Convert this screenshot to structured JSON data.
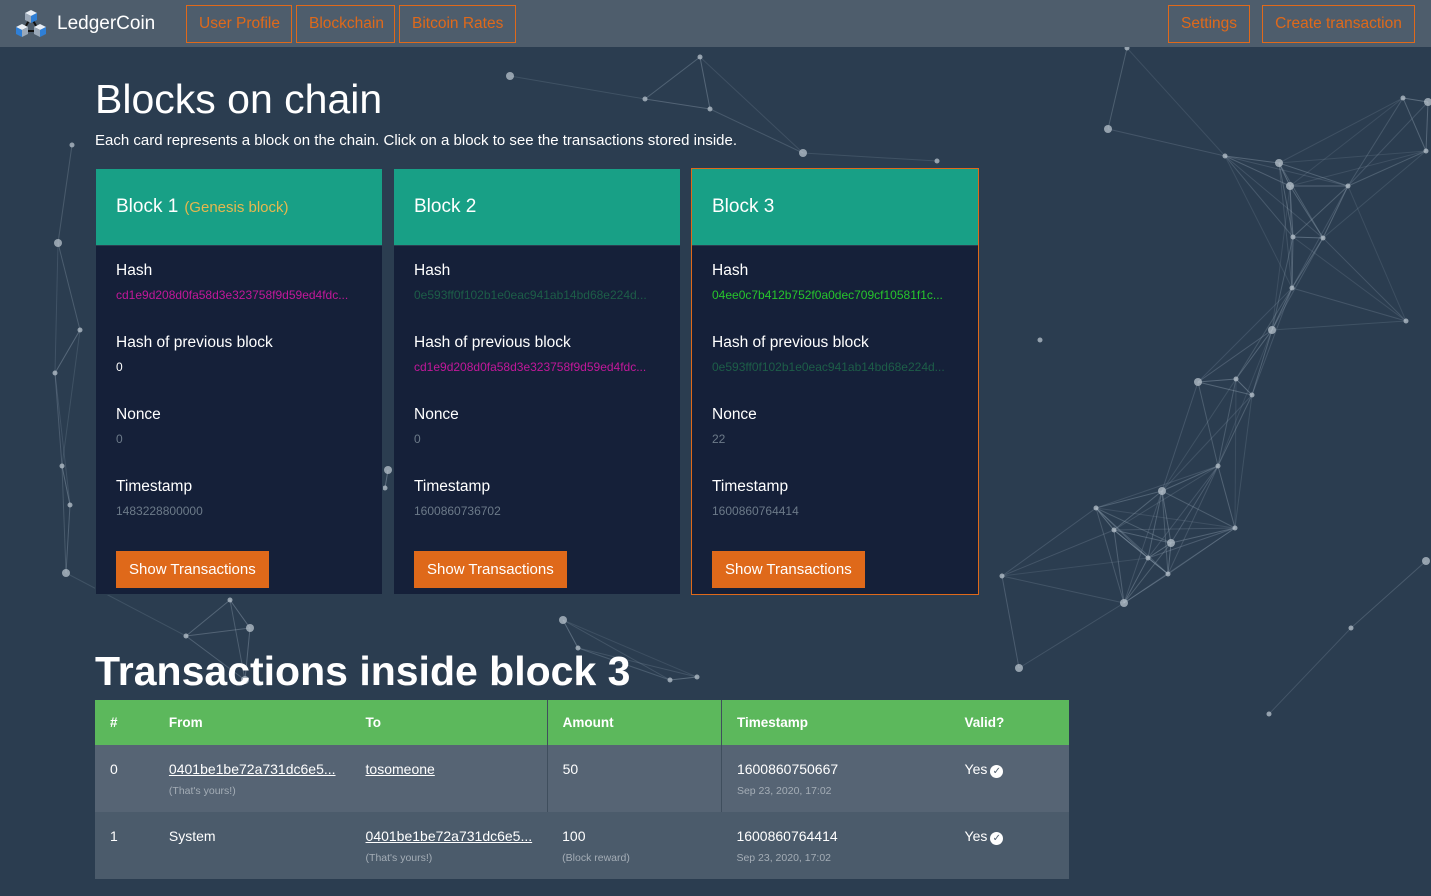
{
  "app": {
    "name": "LedgerCoin",
    "logo_icon": "blockchain-cubes-icon"
  },
  "nav": {
    "left": [
      {
        "label": "User Profile"
      },
      {
        "label": "Blockchain"
      },
      {
        "label": "Bitcoin Rates"
      }
    ],
    "right": [
      {
        "label": "Settings"
      },
      {
        "label": "Create transaction"
      }
    ]
  },
  "blocks_section": {
    "title": "Blocks on chain",
    "subtitle": "Each card represents a block on the chain. Click on a block to see the transactions stored inside."
  },
  "field_labels": {
    "hash": "Hash",
    "prev_hash": "Hash of previous block",
    "nonce": "Nonce",
    "timestamp": "Timestamp",
    "show_transactions": "Show Transactions"
  },
  "blocks": [
    {
      "title": "Block 1",
      "tag": "(Genesis block)",
      "hash": "cd1e9d208d0fa58d3e323758f9d59ed4fdc...",
      "hash_color": "#c2189a",
      "prev_hash": "0",
      "prev_hash_color": "#ffffff",
      "nonce": "0",
      "timestamp": "1483228800000",
      "selected": false
    },
    {
      "title": "Block 2",
      "tag": "",
      "hash": "0e593ff0f102b1e0eac941ab14bd68e224d...",
      "hash_color": "#1d5e48",
      "prev_hash": "cd1e9d208d0fa58d3e323758f9d59ed4fdc...",
      "prev_hash_color": "#c2189a",
      "nonce": "0",
      "timestamp": "1600860736702",
      "selected": false
    },
    {
      "title": "Block 3",
      "tag": "",
      "hash": "04ee0c7b412b752f0a0dec709cf10581f1c...",
      "hash_color": "#27c52c",
      "prev_hash": "0e593ff0f102b1e0eac941ab14bd68e224d...",
      "prev_hash_color": "#1d5e48",
      "nonce": "22",
      "timestamp": "1600860764414",
      "selected": true
    }
  ],
  "transactions_section": {
    "title": "Transactions inside block 3",
    "columns": [
      "#",
      "From",
      "To",
      "Amount",
      "Timestamp",
      "Valid?"
    ],
    "rows": [
      {
        "index": "0",
        "from": "0401be1be72a731dc6e5...",
        "from_note": "(That's yours!)",
        "to": "tosomeone",
        "to_note": "",
        "amount": "50",
        "amount_note": "",
        "timestamp": "1600860750667",
        "date": "Sep 23, 2020, 17:02",
        "valid": "Yes"
      },
      {
        "index": "1",
        "from": "System",
        "from_note": "",
        "to": "0401be1be72a731dc6e5...",
        "to_note": "(That's yours!)",
        "amount": "100",
        "amount_note": "(Block reward)",
        "timestamp": "1600860764414",
        "date": "Sep 23, 2020, 17:02",
        "valid": "Yes"
      }
    ]
  },
  "colors": {
    "accent": "#df691a",
    "card_header": "#18a086",
    "table_header": "#5cb85c",
    "background": "#2b3d50",
    "navbar": "#4e5d6c",
    "muted_value": "#6c7a89",
    "genesis_tag": "#e6b84e"
  }
}
